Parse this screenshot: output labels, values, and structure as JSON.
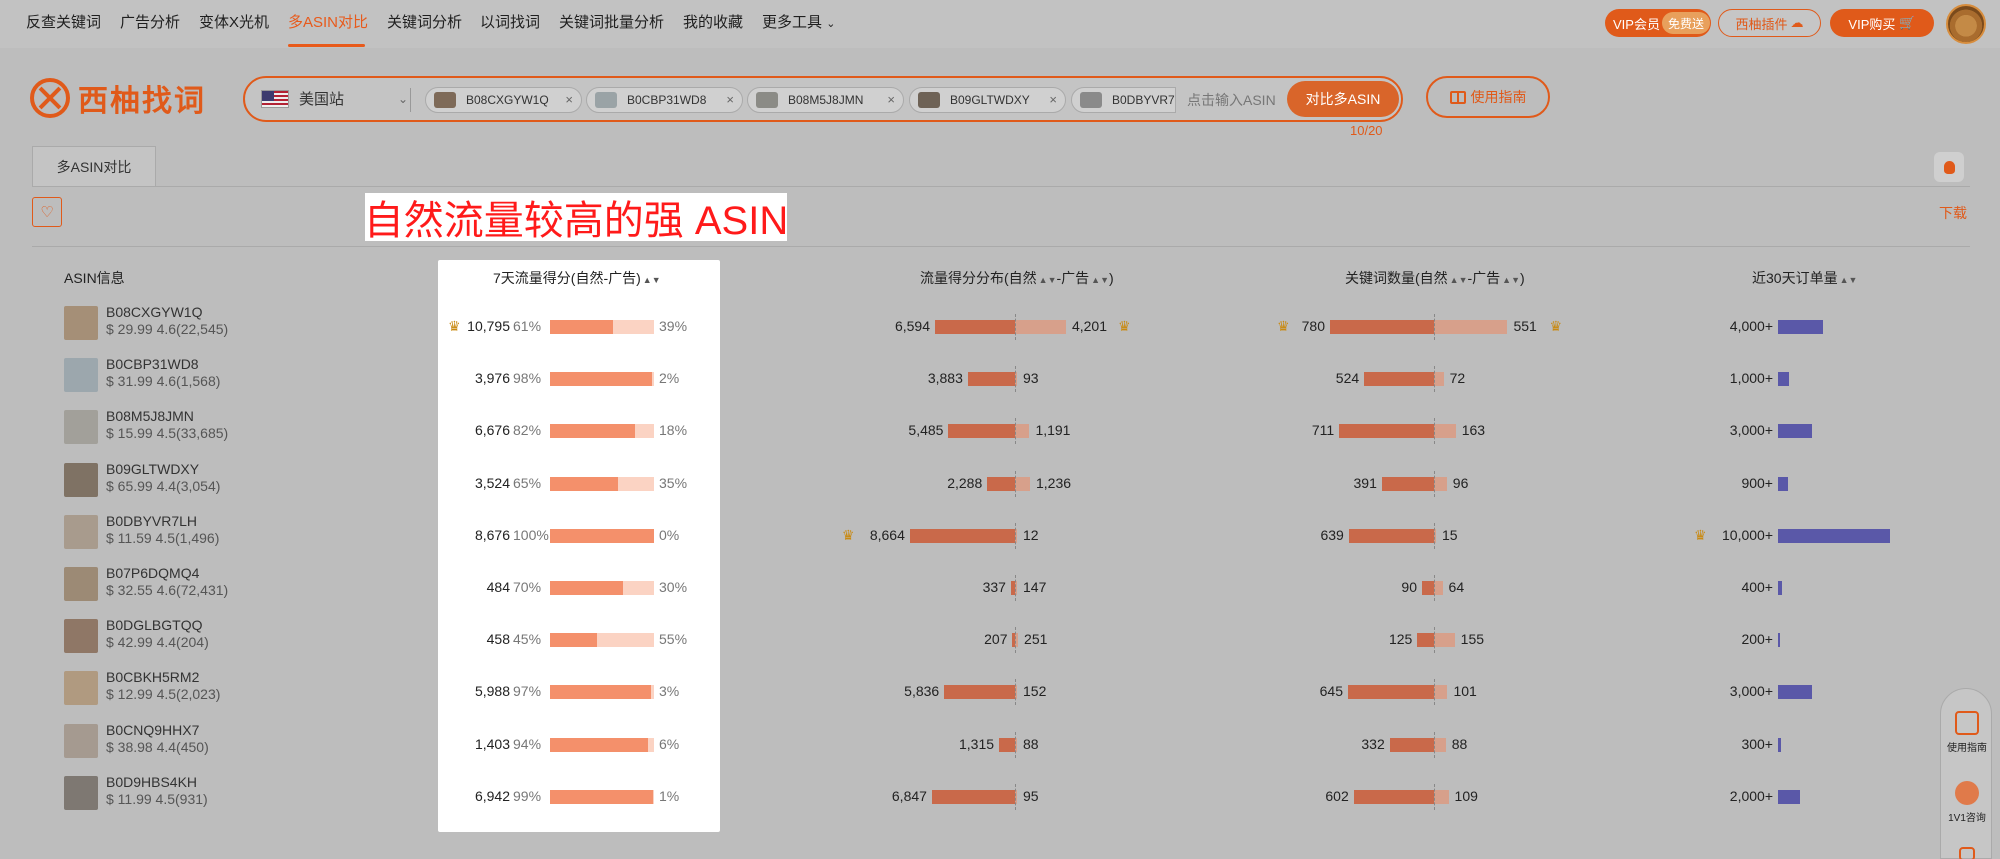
{
  "topnav": {
    "items": [
      "反查关键词",
      "广告分析",
      "变体X光机",
      "多ASIN对比",
      "关键词分析",
      "以词找词",
      "关键词批量分析",
      "我的收藏",
      "更多工具"
    ],
    "more_chevron": "chevron-down-icon",
    "vip_label": "VIP会员",
    "vip_free": "免费送",
    "plugin_label": "西柚插件",
    "vip_buy_label": "VIP购买"
  },
  "logo": {
    "text": "西柚找词"
  },
  "search": {
    "site": "美国站",
    "chips": [
      "B08CXGYW1Q",
      "B0CBP31WD8",
      "B08M5J8JMN",
      "B09GLTWDXY",
      "B0DBYVR7"
    ],
    "placeholder": "点击输入ASIN",
    "compare_label": "对比多ASIN",
    "count": "10/20"
  },
  "guide_label": "使用指南",
  "tab_label": "多ASIN对比",
  "download_label": "下载",
  "annotation": "自然流量较高的强 ASIN",
  "table": {
    "headers": {
      "asin": "ASIN信息",
      "score7": "7天流量得分(自然-广告)",
      "dist": "流量得分分布(自然",
      "dist_ad": "-广告",
      "kw": "关键词数量(自然",
      "kw_ad": "-广告",
      "orders": "近30天订单量"
    },
    "rows": [
      {
        "asin": "B08CXGYW1Q",
        "meta": "$ 29.99  4.6(22,545)",
        "score": "10,795",
        "nat_pct": "61%",
        "ad_pct": "39%",
        "nat": 61,
        "dist_nat": "6,594",
        "dist_ad": "4,201",
        "dist_nat_v": 6594,
        "dist_ad_v": 4201,
        "kw_nat": "780",
        "kw_ad": "551",
        "kw_nat_v": 780,
        "kw_ad_v": 551,
        "orders": "4,000+",
        "orders_v": 4000,
        "crown_score": true,
        "crown_dist_ad": true,
        "crown_kw_nat": true,
        "crown_kw_ad": true,
        "crown_dist_nat": false,
        "crown_orders": false
      },
      {
        "asin": "B0CBP31WD8",
        "meta": "$ 31.99  4.6(1,568)",
        "score": "3,976",
        "nat_pct": "98%",
        "ad_pct": "2%",
        "nat": 98,
        "dist_nat": "3,883",
        "dist_ad": "93",
        "dist_nat_v": 3883,
        "dist_ad_v": 93,
        "kw_nat": "524",
        "kw_ad": "72",
        "kw_nat_v": 524,
        "kw_ad_v": 72,
        "orders": "1,000+",
        "orders_v": 1000
      },
      {
        "asin": "B08M5J8JMN",
        "meta": "$ 15.99  4.5(33,685)",
        "score": "6,676",
        "nat_pct": "82%",
        "ad_pct": "18%",
        "nat": 82,
        "dist_nat": "5,485",
        "dist_ad": "1,191",
        "dist_nat_v": 5485,
        "dist_ad_v": 1191,
        "kw_nat": "711",
        "kw_ad": "163",
        "kw_nat_v": 711,
        "kw_ad_v": 163,
        "orders": "3,000+",
        "orders_v": 3000
      },
      {
        "asin": "B09GLTWDXY",
        "meta": "$ 65.99  4.4(3,054)",
        "score": "3,524",
        "nat_pct": "65%",
        "ad_pct": "35%",
        "nat": 65,
        "dist_nat": "2,288",
        "dist_ad": "1,236",
        "dist_nat_v": 2288,
        "dist_ad_v": 1236,
        "kw_nat": "391",
        "kw_ad": "96",
        "kw_nat_v": 391,
        "kw_ad_v": 96,
        "orders": "900+",
        "orders_v": 900
      },
      {
        "asin": "B0DBYVR7LH",
        "meta": "$ 11.59  4.5(1,496)",
        "score": "8,676",
        "nat_pct": "100%",
        "ad_pct": "0%",
        "nat": 100,
        "dist_nat": "8,664",
        "dist_ad": "12",
        "dist_nat_v": 8664,
        "dist_ad_v": 12,
        "kw_nat": "639",
        "kw_ad": "15",
        "kw_nat_v": 639,
        "kw_ad_v": 15,
        "orders": "10,000+",
        "orders_v": 10000,
        "crown_dist_nat": true,
        "crown_orders": true
      },
      {
        "asin": "B07P6DQMQ4",
        "meta": "$ 32.55  4.6(72,431)",
        "score": "484",
        "nat_pct": "70%",
        "ad_pct": "30%",
        "nat": 70,
        "dist_nat": "337",
        "dist_ad": "147",
        "dist_nat_v": 337,
        "dist_ad_v": 147,
        "kw_nat": "90",
        "kw_ad": "64",
        "kw_nat_v": 90,
        "kw_ad_v": 64,
        "orders": "400+",
        "orders_v": 400
      },
      {
        "asin": "B0DGLBGTQQ",
        "meta": "$ 42.99  4.4(204)",
        "score": "458",
        "nat_pct": "45%",
        "ad_pct": "55%",
        "nat": 45,
        "dist_nat": "207",
        "dist_ad": "251",
        "dist_nat_v": 207,
        "dist_ad_v": 251,
        "kw_nat": "125",
        "kw_ad": "155",
        "kw_nat_v": 125,
        "kw_ad_v": 155,
        "orders": "200+",
        "orders_v": 200
      },
      {
        "asin": "B0CBKH5RM2",
        "meta": "$ 12.99  4.5(2,023)",
        "score": "5,988",
        "nat_pct": "97%",
        "ad_pct": "3%",
        "nat": 97,
        "dist_nat": "5,836",
        "dist_ad": "152",
        "dist_nat_v": 5836,
        "dist_ad_v": 152,
        "kw_nat": "645",
        "kw_ad": "101",
        "kw_nat_v": 645,
        "kw_ad_v": 101,
        "orders": "3,000+",
        "orders_v": 3000
      },
      {
        "asin": "B0CNQ9HHX7",
        "meta": "$ 38.98  4.4(450)",
        "score": "1,403",
        "nat_pct": "94%",
        "ad_pct": "6%",
        "nat": 94,
        "dist_nat": "1,315",
        "dist_ad": "88",
        "dist_nat_v": 1315,
        "dist_ad_v": 88,
        "kw_nat": "332",
        "kw_ad": "88",
        "kw_nat_v": 332,
        "kw_ad_v": 88,
        "orders": "300+",
        "orders_v": 300
      },
      {
        "asin": "B0D9HBS4KH",
        "meta": "$ 11.99  4.5(931)",
        "score": "6,942",
        "nat_pct": "99%",
        "ad_pct": "1%",
        "nat": 99,
        "dist_nat": "6,847",
        "dist_ad": "95",
        "dist_nat_v": 6847,
        "dist_ad_v": 95,
        "kw_nat": "602",
        "kw_ad": "109",
        "kw_nat_v": 602,
        "kw_ad_v": 109,
        "orders": "2,000+",
        "orders_v": 2000
      }
    ]
  },
  "float": {
    "guide": "使用指南",
    "consult": "1V1咨询"
  },
  "colors": {
    "accent": "#e05a1a",
    "natural": "#f4906b",
    "ad": "#fbd3c3",
    "orders": "#5a58a8"
  }
}
